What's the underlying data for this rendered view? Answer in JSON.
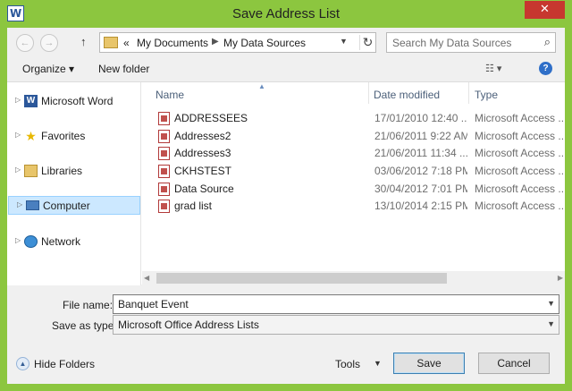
{
  "window": {
    "title": "Save Address List",
    "app_icon_letter": "W",
    "close_glyph": "✕"
  },
  "address_bar": {
    "back_glyph": "←",
    "forward_glyph": "→",
    "up_glyph": "↑",
    "overflow_glyph": "«",
    "crumbs": [
      "My Documents",
      "My Data Sources"
    ],
    "separator_glyph": "▶",
    "dropdown_glyph": "▼",
    "refresh_glyph": "↻"
  },
  "search": {
    "placeholder": "Search My Data Sources",
    "icon": "search-icon"
  },
  "toolbar": {
    "organize_label": "Organize ▾",
    "new_folder_label": "New folder",
    "view_glyph": "☷ ▾",
    "help_glyph": "?"
  },
  "nav": {
    "items": [
      {
        "label": "Microsoft Word",
        "icon": "word-icon",
        "selected": false
      },
      {
        "label": "Favorites",
        "icon": "star-icon",
        "selected": false
      },
      {
        "label": "Libraries",
        "icon": "libraries-icon",
        "selected": false
      },
      {
        "label": "Computer",
        "icon": "computer-icon",
        "selected": true
      },
      {
        "label": "Network",
        "icon": "network-icon",
        "selected": false
      }
    ]
  },
  "file_list": {
    "columns": {
      "name": "Name",
      "date": "Date modified",
      "type": "Type"
    },
    "rows": [
      {
        "name": "ADDRESSEES",
        "date": "17/01/2010 12:40 ...",
        "type": "Microsoft Access ..."
      },
      {
        "name": "Addresses2",
        "date": "21/06/2011 9:22 AM",
        "type": "Microsoft Access ..."
      },
      {
        "name": "Addresses3",
        "date": "21/06/2011 11:34 ...",
        "type": "Microsoft Access ..."
      },
      {
        "name": "CKHSTEST",
        "date": "03/06/2012 7:18 PM",
        "type": "Microsoft Access ..."
      },
      {
        "name": "Data Source",
        "date": "30/04/2012 7:01 PM",
        "type": "Microsoft Access ..."
      },
      {
        "name": "grad list",
        "date": "13/10/2014 2:15 PM",
        "type": "Microsoft Access ..."
      }
    ]
  },
  "form": {
    "file_name_label": "File name:",
    "file_name_value": "Banquet Event",
    "save_type_label": "Save as type:",
    "save_type_value": "Microsoft Office Address Lists"
  },
  "footer": {
    "hide_folders_label": "Hide Folders",
    "tools_label": "Tools",
    "save_label": "Save",
    "cancel_label": "Cancel"
  },
  "colors": {
    "frame": "#8cc63f",
    "close": "#c7372f",
    "selection": "#cce8ff"
  }
}
